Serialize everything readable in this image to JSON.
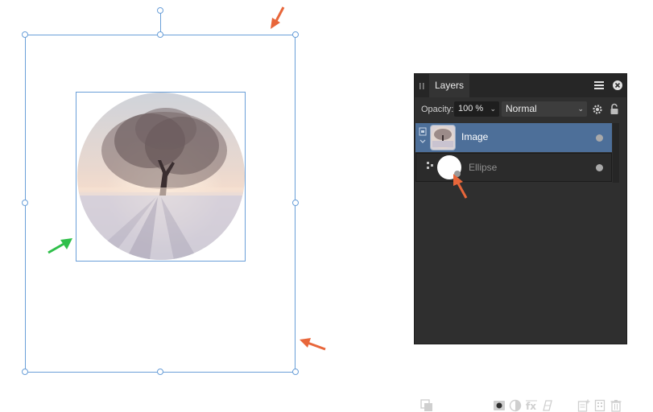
{
  "panel": {
    "title": "Layers",
    "menu_icon": "hamburger-menu-icon",
    "close_icon": "close-icon",
    "opacity_label": "Opacity:",
    "opacity_value": "100 %",
    "blend_mode": "Normal",
    "settings_icon": "gear-icon",
    "lock_icon": "lock-icon"
  },
  "layers": [
    {
      "name": "Image",
      "selected": true,
      "visible": true
    },
    {
      "name": "Ellipse",
      "selected": false,
      "visible": true
    }
  ],
  "footer_icons": [
    "arrange-icon",
    "mask-icon",
    "adjustment-icon",
    "fx-icon",
    "live-filter-icon",
    "add-pixel-layer-icon",
    "add-group-icon",
    "delete-icon"
  ],
  "colors": {
    "selection": "#6a9fd8",
    "annotation_arrow_orange": "#e8663a",
    "annotation_arrow_green": "#2fbf4a",
    "selected_row": "#4d6f99",
    "panel_bg": "#2f2f2f"
  }
}
